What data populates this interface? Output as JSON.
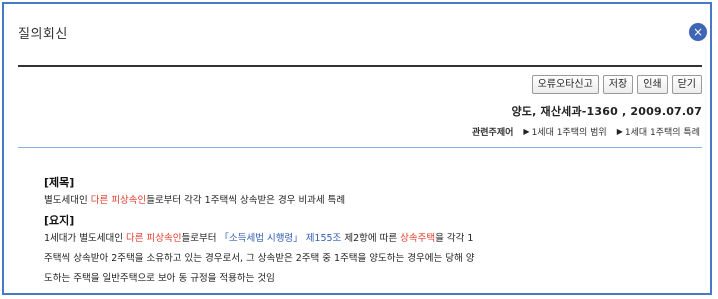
{
  "window": {
    "title": "질의회신",
    "close_glyph": "×"
  },
  "toolbar": {
    "buttons": [
      "오류오타신고",
      "저장",
      "인쇄",
      "닫기"
    ]
  },
  "doc_ref": "양도, 재산세과-1360 , 2009.07.07",
  "related": {
    "label": "관련주제어",
    "items": [
      "1세대 1주택의 범위",
      "1세대 1주택의 특례"
    ]
  },
  "content": {
    "title_heading": "[제목]",
    "title_text": "별도세대인 다른 피상속인들로부터 각각 1주택씩 상속받은 경우 비과세 특례",
    "summary_heading": "[요지]",
    "summary_lines": [
      "1세대가 별도세대인 다른 피상속인들로부터 「소득세법 시행령」 제155조 제2항에 따른 상속주택을 각각 1",
      "주택씩 상속받아 2주택을 소유하고 있는 경우로서, 그 상속받은 2주택 중 1주택을 양도하는 경우에는 당해 양",
      "도하는 주택을 일반주택으로 보아 동 규정을 적용하는 것임"
    ]
  },
  "colors": {
    "border": "#4a78c8",
    "close_bg": "#3f65b5",
    "highlight_red": "#e53a2a",
    "link_blue": "#2f5fb3"
  }
}
